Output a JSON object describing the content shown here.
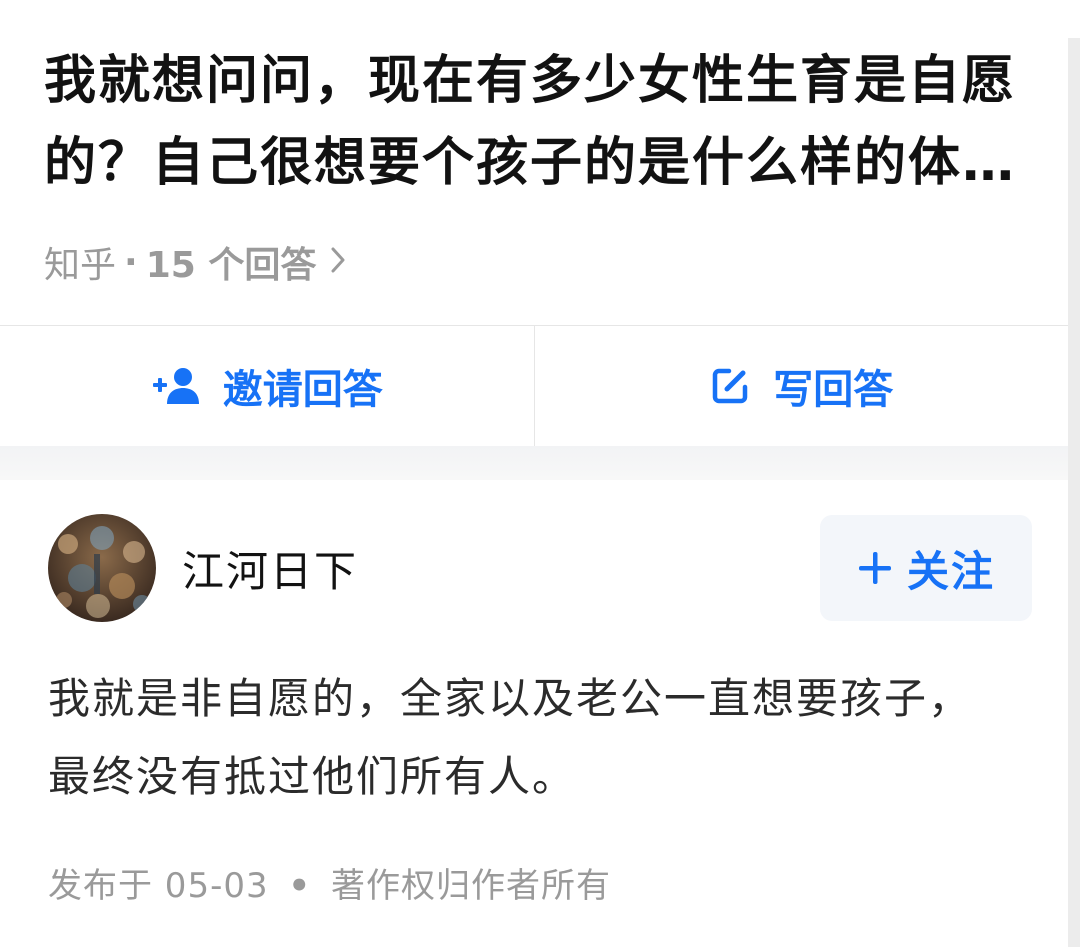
{
  "question": {
    "title": "我就想问问，现在有多少女性生育是自愿的？自己很想要个孩子的是什么样的体验？",
    "source": "知乎",
    "separator": "·",
    "answer_count": "15 个回答",
    "chevron": "›"
  },
  "actions": {
    "invite_label": "邀请回答",
    "invite_icon": "add-user-icon",
    "write_label": "写回答",
    "write_icon": "edit-icon",
    "accent_color": "#1772f6"
  },
  "answer": {
    "author_name": "江河日下",
    "follow_label": "关注",
    "follow_icon": "plus-icon",
    "content": "我就是非自愿的，全家以及老公一直想要孩子，最终没有抵过他们所有人。",
    "published_label": "发布于 05-03",
    "meta_separator": "•",
    "copyright": "著作权归作者所有"
  }
}
